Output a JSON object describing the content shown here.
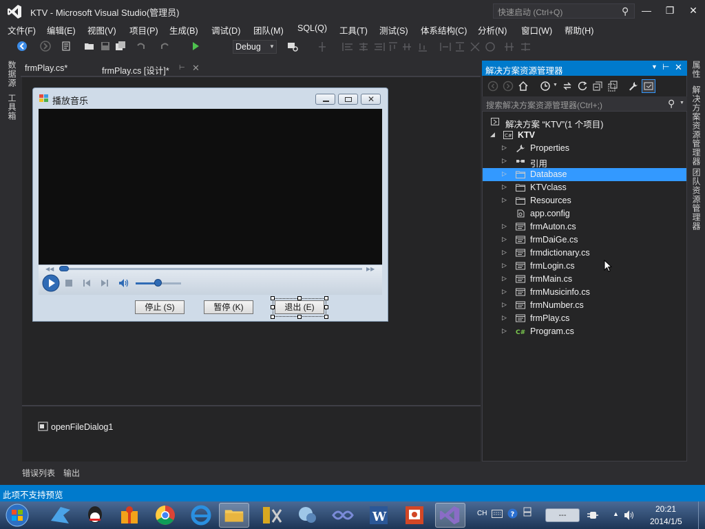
{
  "window": {
    "title": "KTV - Microsoft Visual Studio(管理员)",
    "quick_launch_placeholder": "快速启动 (Ctrl+Q)",
    "minimize": "—",
    "maximize": "❐",
    "close": "✕"
  },
  "menu": [
    "文件(F)",
    "编辑(E)",
    "视图(V)",
    "项目(P)",
    "生成(B)",
    "调试(D)",
    "团队(M)",
    "SQL(Q)",
    "工具(T)",
    "测试(S)",
    "体系结构(C)",
    "分析(N)",
    "窗口(W)",
    "帮助(H)"
  ],
  "toolbar": {
    "start_label": "启动",
    "config": "Debug"
  },
  "left_strip": [
    "数据源",
    "工具箱"
  ],
  "right_strip": [
    "属性",
    "解决方案资源管理器",
    "团队资源管理器"
  ],
  "doc_tabs": [
    {
      "label": "frmPlay.cs*"
    },
    {
      "label": "frmPlay.cs [设计]*"
    }
  ],
  "form": {
    "caption": "播放音乐",
    "buttons": [
      "停止 (S)",
      "暂停 (K)",
      "退出 (E)"
    ]
  },
  "tray": {
    "component": "openFileDialog1"
  },
  "bottom_tabs": [
    "错误列表",
    "输出"
  ],
  "solution_explorer": {
    "title": "解决方案资源管理器",
    "search_placeholder": "搜索解决方案资源管理器(Ctrl+;)",
    "solution_label": "解决方案 “KTV”(1 个项目)",
    "project": "KTV",
    "items": [
      {
        "label": "Properties",
        "icon": "wrench-icon",
        "expandable": true
      },
      {
        "label": "引用",
        "icon": "references-icon",
        "expandable": true
      },
      {
        "label": "Database",
        "icon": "folder-icon",
        "expandable": true,
        "selected": true
      },
      {
        "label": "KTVclass",
        "icon": "folder-icon",
        "expandable": true
      },
      {
        "label": "Resources",
        "icon": "folder-icon",
        "expandable": true
      },
      {
        "label": "app.config",
        "icon": "config-file-icon",
        "expandable": false
      },
      {
        "label": "frmAuton.cs",
        "icon": "form-file-icon",
        "expandable": true
      },
      {
        "label": "frmDaiGe.cs",
        "icon": "form-file-icon",
        "expandable": true
      },
      {
        "label": "frmdictionary.cs",
        "icon": "form-file-icon",
        "expandable": true
      },
      {
        "label": "frmLogin.cs",
        "icon": "form-file-icon",
        "expandable": true
      },
      {
        "label": "frmMain.cs",
        "icon": "form-file-icon",
        "expandable": true
      },
      {
        "label": "frmMusicinfo.cs",
        "icon": "form-file-icon",
        "expandable": true
      },
      {
        "label": "frmNumber.cs",
        "icon": "form-file-icon",
        "expandable": true
      },
      {
        "label": "frmPlay.cs",
        "icon": "form-file-icon",
        "expandable": true
      },
      {
        "label": "Program.cs",
        "icon": "csharp-file-icon",
        "expandable": true
      }
    ]
  },
  "status": {
    "text": "此项不支持预览"
  },
  "taskbar": {
    "ime": "CH",
    "time": "20:21",
    "date": "2014/1/5"
  },
  "colors": {
    "accent": "#007acc",
    "selection": "#3399ff",
    "background": "#2d2d30"
  }
}
